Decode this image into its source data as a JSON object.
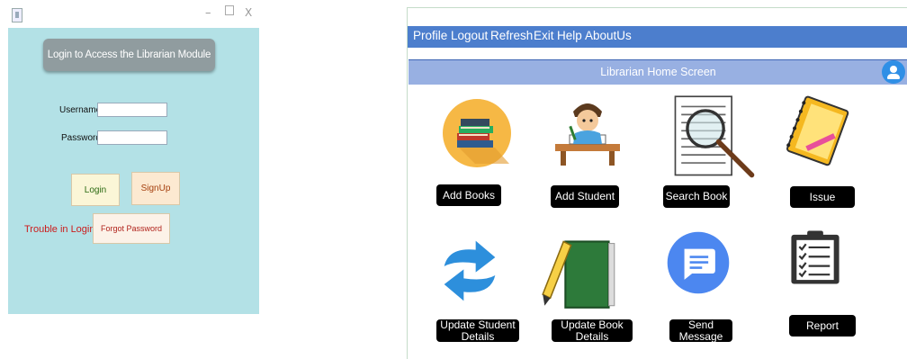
{
  "login_window": {
    "window_controls": {
      "minimize": "–",
      "close": "X"
    },
    "banner": "Login to Access the Librarian Module",
    "username_label": "Username :",
    "username_value": "",
    "password_label": "Password :",
    "password_value": "",
    "login_button": "Login",
    "signup_button": "SignUp",
    "trouble_text": "Trouble in Login?",
    "forgot_button": "Forgot Password"
  },
  "librarian_window": {
    "menu": [
      "Profile",
      "Logout",
      "Refresh",
      "Exit",
      "Help",
      "AboutUs"
    ],
    "header_title": "Librarian Home Screen",
    "tiles": [
      {
        "label": "Add Books",
        "icon": "books-icon"
      },
      {
        "label": "Add Student",
        "icon": "student-icon"
      },
      {
        "label": "Search Book",
        "icon": "magnifier-icon"
      },
      {
        "label": "Issue",
        "icon": "notebook-icon"
      },
      {
        "label": "Update Student Details",
        "icon": "refresh-arrows-icon"
      },
      {
        "label": "Update Book Details",
        "icon": "book-pencil-icon"
      },
      {
        "label": "Send Message",
        "icon": "message-icon"
      },
      {
        "label": "Report",
        "icon": "clipboard-icon"
      }
    ]
  },
  "colors": {
    "login_bg": "#b3e1e6",
    "menu_bar": "#4c7ecd",
    "header_bar": "#98b0e2",
    "avatar": "#2f8fe6"
  }
}
